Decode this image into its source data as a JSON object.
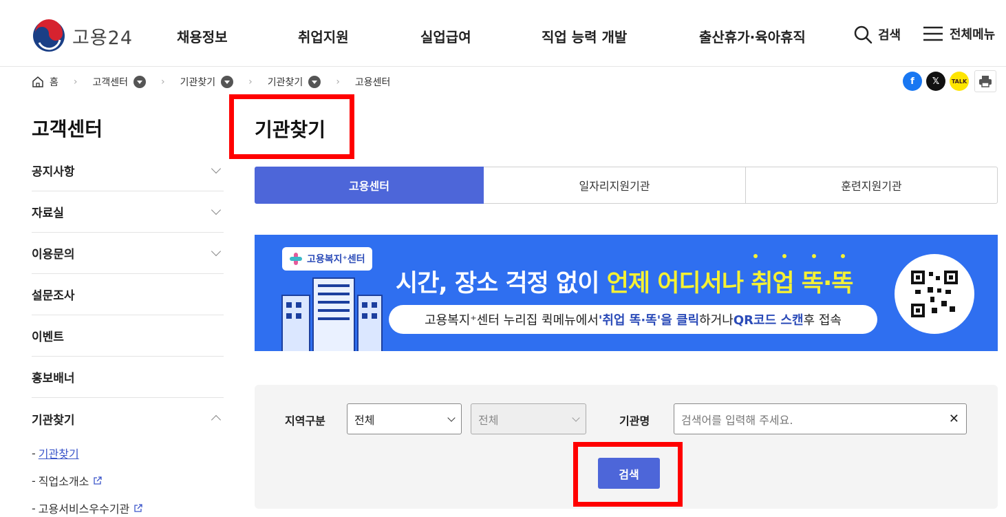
{
  "header": {
    "logo_text": "고용24",
    "nav": [
      "채용정보",
      "취업지원",
      "실업급여",
      "직업 능력 개발",
      "출산휴가·육아휴직"
    ],
    "search_label": "검색",
    "menu_label": "전체메뉴"
  },
  "breadcrumb": {
    "home": "홈",
    "items": [
      "고객센터",
      "기관찾기",
      "기관찾기",
      "고용센터"
    ]
  },
  "share": {
    "talk_label": "TALK"
  },
  "sidebar": {
    "title": "고객센터",
    "items": [
      "공지사항",
      "자료실",
      "이용문의",
      "설문조사",
      "이벤트",
      "홍보배너",
      "기관찾기"
    ],
    "sub_items": [
      "기관찾기",
      "직업소개소",
      "고용서비스우수기관"
    ]
  },
  "main": {
    "title": "기관찾기",
    "tabs": [
      "고용센터",
      "일자리지원기관",
      "훈련지원기관"
    ]
  },
  "banner": {
    "badge": "고용복지⁺센터",
    "headline_a": "시간, 장소 걱정 없이 ",
    "headline_b": "언제 어디서나 취업 똑·똑",
    "sub_a": "고용복지⁺센터 누리집 퀵메뉴에서 ",
    "sub_b": "'취업 똑·똑'을 클릭",
    "sub_c": "하거나 ",
    "sub_d": "QR코드 스캔",
    "sub_e": " 후 접속"
  },
  "search": {
    "region_label": "지역구분",
    "region_value": "전체",
    "subregion_value": "전체",
    "name_label": "기관명",
    "name_placeholder": "검색어를 입력해 주세요.",
    "button": "검색"
  },
  "colors": {
    "accent": "#4d66d9",
    "banner": "#2f6ff0",
    "highlight": "#ff0000"
  }
}
